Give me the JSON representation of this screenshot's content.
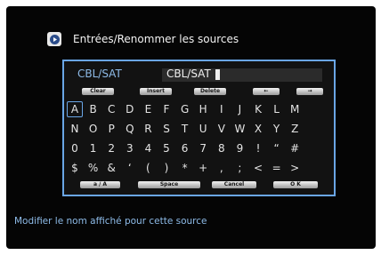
{
  "header": {
    "icon": "input-source-icon",
    "title": "Entrées/Renommer les sources"
  },
  "editor": {
    "source_label": "CBL/SAT",
    "source_value": "CBL/SAT",
    "top_buttons": [
      "Clear",
      "Insert",
      "Delete",
      "←",
      "→"
    ],
    "keys": [
      [
        "A",
        "B",
        "C",
        "D",
        "E",
        "F",
        "G",
        "H",
        "I",
        "J",
        "K",
        "L",
        "M"
      ],
      [
        "N",
        "O",
        "P",
        "Q",
        "R",
        "S",
        "T",
        "U",
        "V",
        "W",
        "X",
        "Y",
        "Z"
      ],
      [
        "0",
        "1",
        "2",
        "3",
        "4",
        "5",
        "6",
        "7",
        "8",
        "9",
        "!",
        "“",
        "#"
      ],
      [
        "$",
        "%",
        "&",
        "‘",
        "(",
        ")",
        "*",
        "+",
        ",",
        ";",
        "<",
        "=",
        ">"
      ]
    ],
    "selected_key": "A",
    "bottom_buttons": [
      "a / A",
      "Space",
      "Cancel",
      "O K"
    ]
  },
  "hint": "Modifier le nom affiché pour cette source",
  "colors": {
    "accent": "#6aa6e6",
    "label": "#8ebbe8",
    "background": "#050505"
  }
}
